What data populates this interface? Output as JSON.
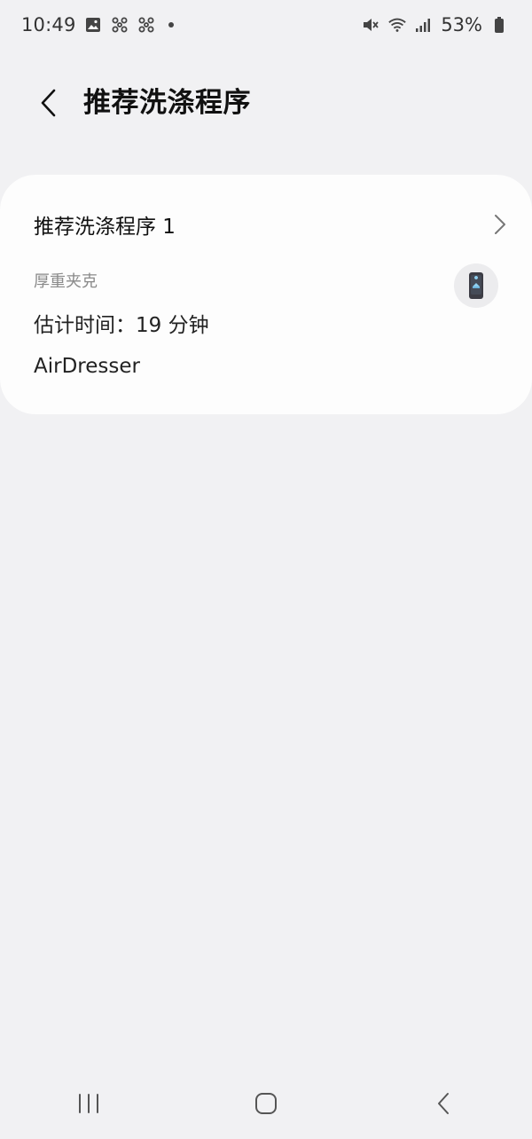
{
  "status_bar": {
    "time": "10:49",
    "battery": "53%",
    "icons_left": [
      "gallery-icon",
      "fan-icon",
      "fan-icon",
      "notification-dot"
    ],
    "icons_right": [
      "mute-icon",
      "wifi-icon",
      "signal-icon",
      "battery-icon"
    ]
  },
  "header": {
    "title": "推荐洗涤程序"
  },
  "card": {
    "title": "推荐洗涤程序 1",
    "subtitle": "厚重夹克",
    "time": "估计时间：19 分钟",
    "device": "AirDresser"
  },
  "nav": {
    "recents_icon": "recents-icon",
    "home_icon": "home-icon",
    "back_icon": "back-icon"
  },
  "colors": {
    "background": "#f1f1f3",
    "card": "#fdfdfd",
    "subtitle": "#8a8a8a"
  }
}
